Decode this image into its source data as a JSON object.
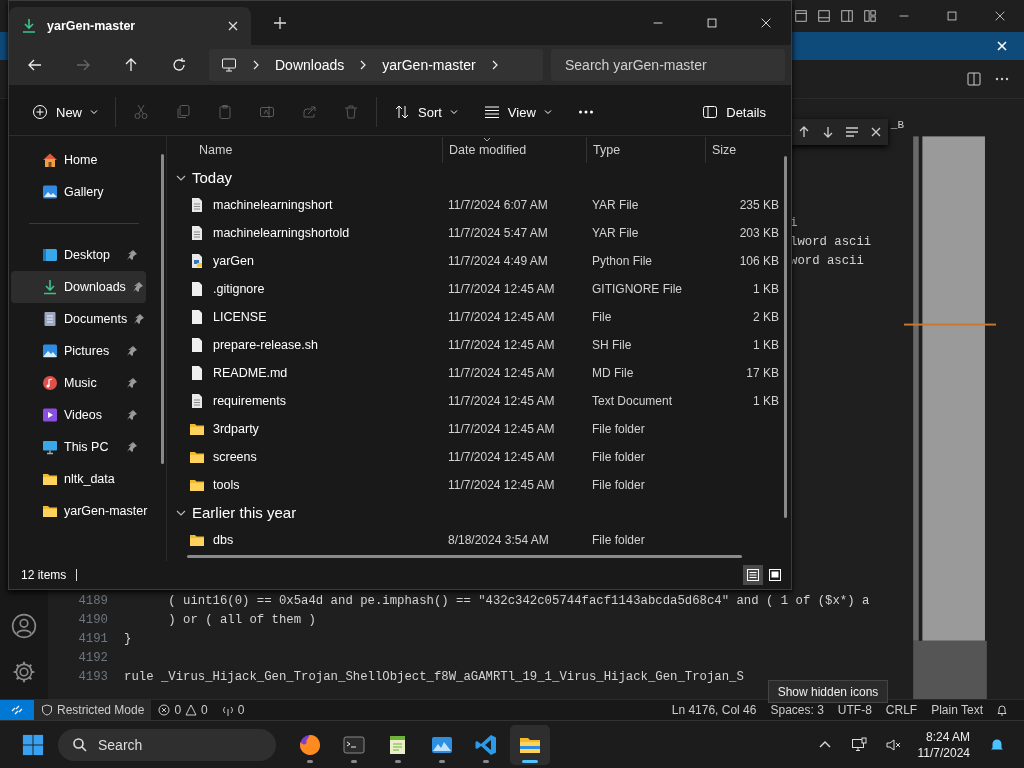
{
  "vscode": {
    "find_fragment": "_B",
    "code_top": [
      "i",
      "lword ascii",
      "word ascii"
    ],
    "code_bottom": [
      {
        "number": "4189",
        "text": "      ( uint16(0) == 0x5a4d and pe.imphash() == \"432c342c05744facf1143abcda5d68c4\" and ( 1 of ($x*) a"
      },
      {
        "number": "4190",
        "text": "      ) or ( all of them )"
      },
      {
        "number": "4191",
        "text": "}"
      },
      {
        "number": "4192"
      },
      {
        "number": "4193",
        "text": "rule _Virus_Hijack_Gen_Trojan_ShellObject_f8W_aGAMRTl_19_1_Virus_Hijack_Gen_Trojan_S"
      }
    ],
    "status_bar": {
      "mode": "Restricted Mode",
      "errors": "0",
      "warnings": "0",
      "ports": "0",
      "right": [
        "Ln 4176, Col 46",
        "Spaces: 3",
        "UTF-8",
        "CRLF",
        "Plain Text"
      ]
    }
  },
  "explorer": {
    "tab": {
      "title": "yarGen-master"
    },
    "breadcrumb": [
      "Downloads",
      "yarGen-master"
    ],
    "search": {
      "placeholder": "Search yarGen-master"
    },
    "commands": [
      {
        "kind": "new",
        "label": "New",
        "disabled": false
      },
      {
        "kind": "cut",
        "disabled": true
      },
      {
        "kind": "copy",
        "disabled": true
      },
      {
        "kind": "paste",
        "disabled": true
      },
      {
        "kind": "rename",
        "disabled": true
      },
      {
        "kind": "share",
        "disabled": true
      },
      {
        "kind": "delete",
        "disabled": true
      },
      {
        "kind": "sort",
        "label": "Sort",
        "disabled": false
      },
      {
        "kind": "view",
        "label": "View",
        "disabled": false
      },
      {
        "kind": "more",
        "disabled": false
      }
    ],
    "details_button": "Details",
    "sidebar": {
      "top": [
        {
          "label": "Home",
          "kind": "home",
          "selected": false
        },
        {
          "label": "Gallery",
          "kind": "gallery",
          "selected": false
        }
      ],
      "places": [
        {
          "label": "Desktop",
          "kind": "desktop",
          "pinned": true,
          "selected": false
        },
        {
          "label": "Downloads",
          "kind": "download",
          "pinned": true,
          "selected": true
        },
        {
          "label": "Documents",
          "kind": "document",
          "pinned": true,
          "selected": false
        },
        {
          "label": "Pictures",
          "kind": "picture",
          "pinned": true,
          "selected": false
        },
        {
          "label": "Music",
          "kind": "music",
          "pinned": true,
          "selected": false
        },
        {
          "label": "Videos",
          "kind": "video",
          "pinned": true,
          "selected": false
        },
        {
          "label": "This PC",
          "kind": "pc",
          "pinned": true,
          "selected": false
        },
        {
          "label": "nltk_data",
          "kind": "folder",
          "pinned": false,
          "selected": false
        },
        {
          "label": "yarGen-master",
          "kind": "folder",
          "pinned": false,
          "selected": false
        }
      ]
    },
    "columns": [
      {
        "label": "Name",
        "sorted": false
      },
      {
        "label": "Date modified",
        "sorted": true
      },
      {
        "label": "Type",
        "sorted": false
      },
      {
        "label": "Size",
        "sorted": false
      }
    ],
    "groups": [
      {
        "label": "Today",
        "expanded": true,
        "files": [
          {
            "name": "machinelearningshort",
            "date": "11/7/2024 6:07 AM",
            "type": "YAR File",
            "size": "235 KB",
            "kind": "text"
          },
          {
            "name": "machinelearningshortold",
            "date": "11/7/2024 5:47 AM",
            "type": "YAR File",
            "size": "203 KB",
            "kind": "text"
          },
          {
            "name": "yarGen",
            "date": "11/7/2024 4:49 AM",
            "type": "Python File",
            "size": "106 KB",
            "kind": "python"
          },
          {
            "name": ".gitignore",
            "date": "11/7/2024 12:45 AM",
            "type": "GITIGNORE File",
            "size": "1 KB",
            "kind": "blank"
          },
          {
            "name": "LICENSE",
            "date": "11/7/2024 12:45 AM",
            "type": "File",
            "size": "2 KB",
            "kind": "blank"
          },
          {
            "name": "prepare-release.sh",
            "date": "11/7/2024 12:45 AM",
            "type": "SH File",
            "size": "1 KB",
            "kind": "blank"
          },
          {
            "name": "README.md",
            "date": "11/7/2024 12:45 AM",
            "type": "MD File",
            "size": "17 KB",
            "kind": "blank"
          },
          {
            "name": "requirements",
            "date": "11/7/2024 12:45 AM",
            "type": "Text Document",
            "size": "1 KB",
            "kind": "text"
          },
          {
            "name": "3rdparty",
            "date": "11/7/2024 12:45 AM",
            "type": "File folder",
            "kind": "folder"
          },
          {
            "name": "screens",
            "date": "11/7/2024 12:45 AM",
            "type": "File folder",
            "kind": "folder"
          },
          {
            "name": "tools",
            "date": "11/7/2024 12:45 AM",
            "type": "File folder",
            "kind": "folder"
          }
        ]
      },
      {
        "label": "Earlier this year",
        "expanded": true,
        "files": [
          {
            "name": "dbs",
            "date": "8/18/2024 3:54 AM",
            "type": "File folder",
            "kind": "folder"
          }
        ]
      }
    ],
    "status": "12 items",
    "views": [
      {
        "kind": "details",
        "selected": true
      },
      {
        "kind": "tiles",
        "selected": false
      }
    ]
  },
  "taskbar": {
    "search": {
      "placeholder": "Search"
    },
    "apps": [
      {
        "kind": "firefox",
        "active": false
      },
      {
        "kind": "terminal",
        "active": false
      },
      {
        "kind": "notepad",
        "active": false
      },
      {
        "kind": "photos",
        "active": false
      },
      {
        "kind": "vscode",
        "active": false
      },
      {
        "kind": "explorer",
        "active": true
      }
    ],
    "time": "8:24 AM",
    "date": "11/7/2024"
  },
  "tooltip": "Show hidden icons"
}
